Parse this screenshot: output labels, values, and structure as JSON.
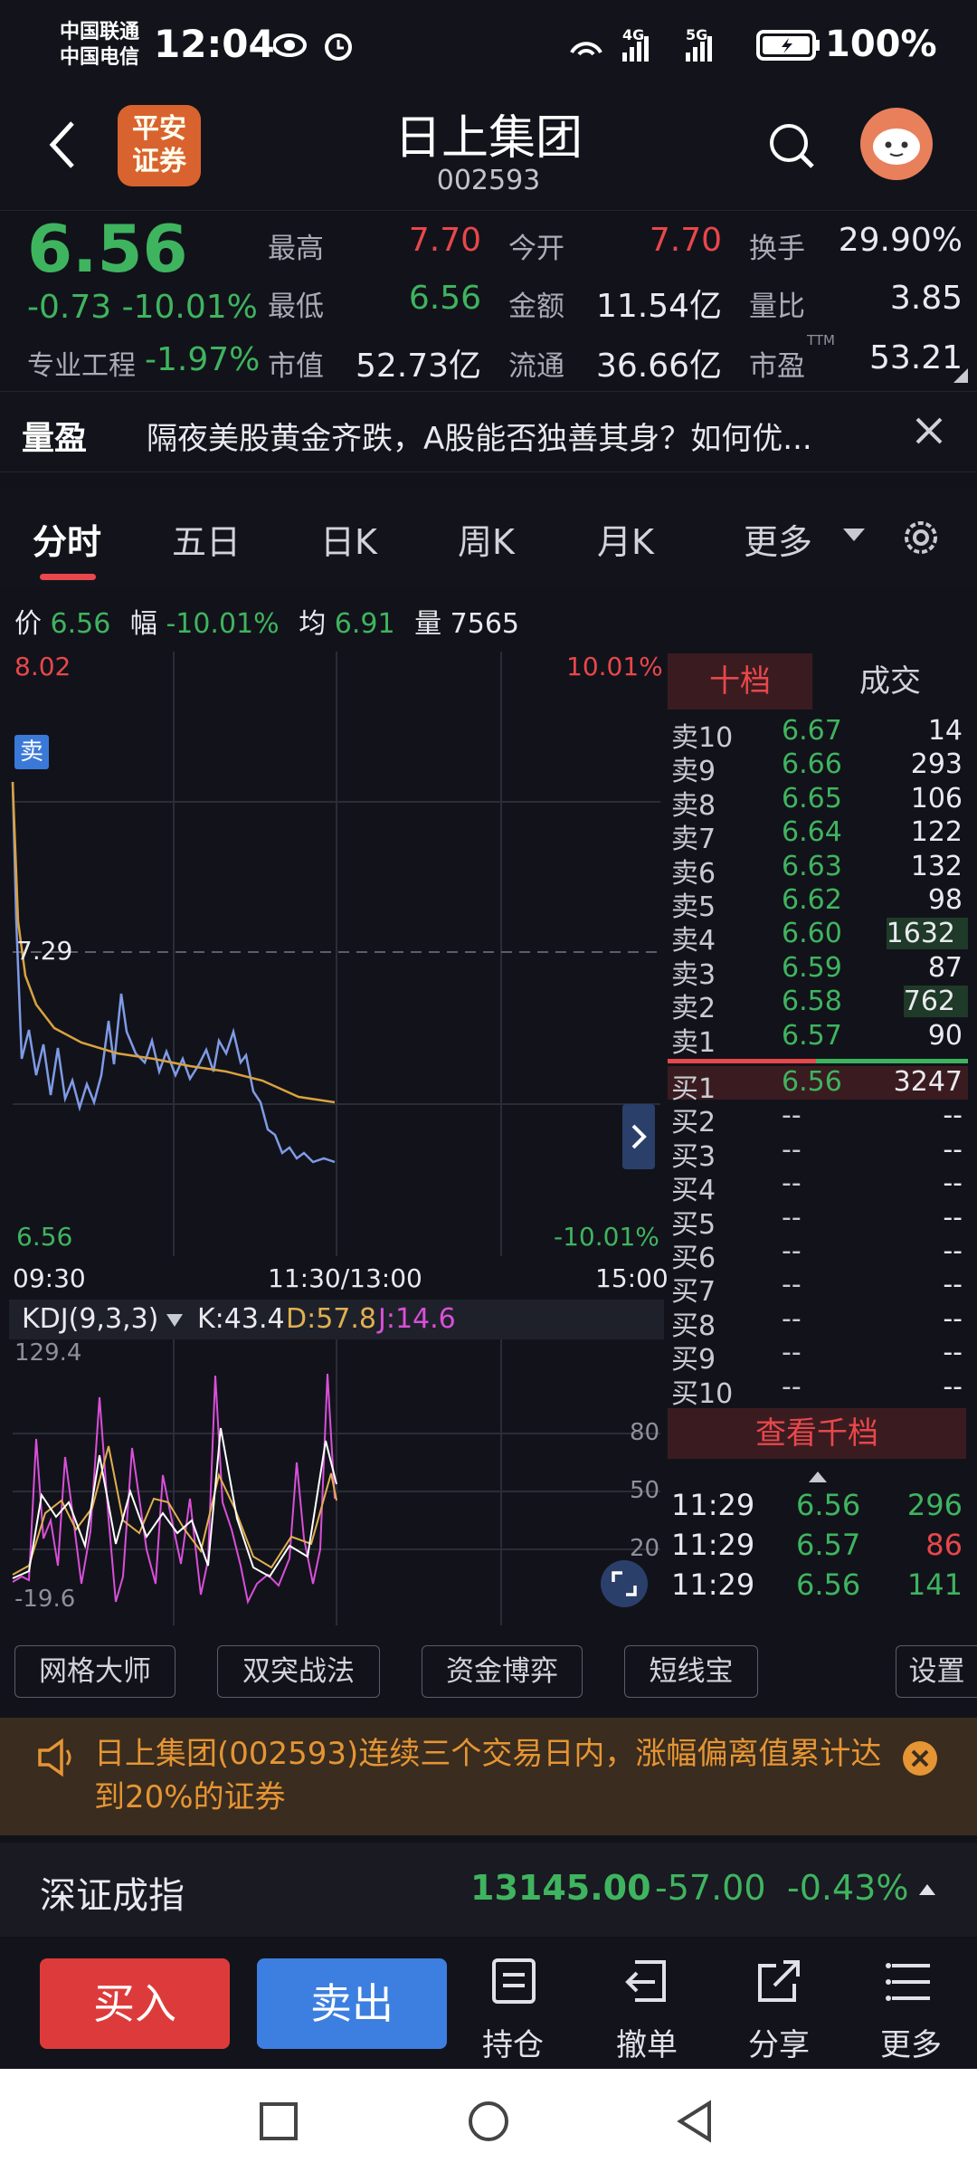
{
  "status_bar": {
    "carrier1": "中国联通",
    "carrier2": "中国电信",
    "time": "12:04",
    "battery": "100%"
  },
  "header": {
    "broker_logo_line1": "平安",
    "broker_logo_line2": "证券",
    "title": "日上集团",
    "code": "002593"
  },
  "quote": {
    "price": "6.56",
    "change": "-0.73",
    "change_pct": "-10.01%",
    "sector_label": "专业工程",
    "sector_change": "-1.97%",
    "fields": {
      "high_label": "最高",
      "high": "7.70",
      "open_label": "今开",
      "open": "7.70",
      "turnover_label": "换手",
      "turnover": "29.90%",
      "low_label": "最低",
      "low": "6.56",
      "amount_label": "金额",
      "amount": "11.54亿",
      "vol_ratio_label": "量比",
      "vol_ratio": "3.85",
      "mktcap_label": "市值",
      "mktcap": "52.73亿",
      "float_label": "流通",
      "float": "36.66亿",
      "pe_label": "市盈",
      "pe_sup": "TTM",
      "pe": "53.21"
    }
  },
  "news": {
    "tag": "量盈",
    "text": "隔夜美股黄金齐跌，A股能否独善其身？如何优..."
  },
  "tabs": [
    "分时",
    "五日",
    "日K",
    "周K",
    "月K",
    "更多"
  ],
  "info_line": {
    "price_label": "价",
    "price": "6.56",
    "pct_label": "幅",
    "pct": "-10.01%",
    "avg_label": "均",
    "avg": "6.91",
    "vol_label": "量",
    "vol": "7565"
  },
  "chart": {
    "top_price": "8.02",
    "top_pct": "10.01%",
    "mid_price": "7.29",
    "bottom_price": "6.56",
    "bottom_pct": "-10.01%",
    "sell_badge": "卖",
    "time_start": "09:30",
    "time_mid": "11:30/13:00",
    "time_end": "15:00",
    "kdj_label": "KDJ(9,3,3)",
    "k_label": "K:43.4",
    "d_label": "D:57.8",
    "j_label": "J:14.6",
    "kdj_max": "129.4",
    "kdj_min": "-19.6",
    "kdj_80": "80",
    "kdj_50": "50",
    "kdj_20": "20"
  },
  "order_book": {
    "tab_active": "十档",
    "tab_other": "成交",
    "asks": [
      {
        "label": "卖10",
        "price": "6.67",
        "vol": "14"
      },
      {
        "label": "卖9",
        "price": "6.66",
        "vol": "293"
      },
      {
        "label": "卖8",
        "price": "6.65",
        "vol": "106"
      },
      {
        "label": "卖7",
        "price": "6.64",
        "vol": "122"
      },
      {
        "label": "卖6",
        "price": "6.63",
        "vol": "132"
      },
      {
        "label": "卖5",
        "price": "6.62",
        "vol": "98"
      },
      {
        "label": "卖4",
        "price": "6.60",
        "vol": "1632"
      },
      {
        "label": "卖3",
        "price": "6.59",
        "vol": "87"
      },
      {
        "label": "卖2",
        "price": "6.58",
        "vol": "762"
      },
      {
        "label": "卖1",
        "price": "6.57",
        "vol": "90"
      }
    ],
    "bids": [
      {
        "label": "买1",
        "price": "6.56",
        "vol": "3247"
      },
      {
        "label": "买2",
        "price": "--",
        "vol": "--"
      },
      {
        "label": "买3",
        "price": "--",
        "vol": "--"
      },
      {
        "label": "买4",
        "price": "--",
        "vol": "--"
      },
      {
        "label": "买5",
        "price": "--",
        "vol": "--"
      },
      {
        "label": "买6",
        "price": "--",
        "vol": "--"
      },
      {
        "label": "买7",
        "price": "--",
        "vol": "--"
      },
      {
        "label": "买8",
        "price": "--",
        "vol": "--"
      },
      {
        "label": "买9",
        "price": "--",
        "vol": "--"
      },
      {
        "label": "买10",
        "price": "--",
        "vol": "--"
      }
    ],
    "view_more": "查看千档",
    "trades": [
      {
        "time": "11:29",
        "price": "6.56",
        "vol": "296"
      },
      {
        "time": "11:29",
        "price": "6.57",
        "vol": "86"
      },
      {
        "time": "11:29",
        "price": "6.56",
        "vol": "141"
      }
    ]
  },
  "tools": [
    "网格大师",
    "双突战法",
    "资金博弈",
    "短线宝",
    "设置"
  ],
  "notice": {
    "text": "日上集团(002593)连续三个交易日内，涨幅偏离值累计达到20%的证券"
  },
  "index": {
    "name": "深证成指",
    "value": "13145.00",
    "change": "-57.00",
    "pct": "-0.43%"
  },
  "bottom_bar": {
    "buy": "买入",
    "sell": "卖出",
    "positions": "持仓",
    "cancel": "撤单",
    "share": "分享",
    "more": "更多"
  },
  "colors": {
    "up": "#e8474b",
    "down": "#3fb45f",
    "price_line": "#7f9be6",
    "avg_line": "#d9a23f",
    "k_line": "#ffffff",
    "d_line": "#e0b050",
    "j_line": "#d94fd9"
  }
}
